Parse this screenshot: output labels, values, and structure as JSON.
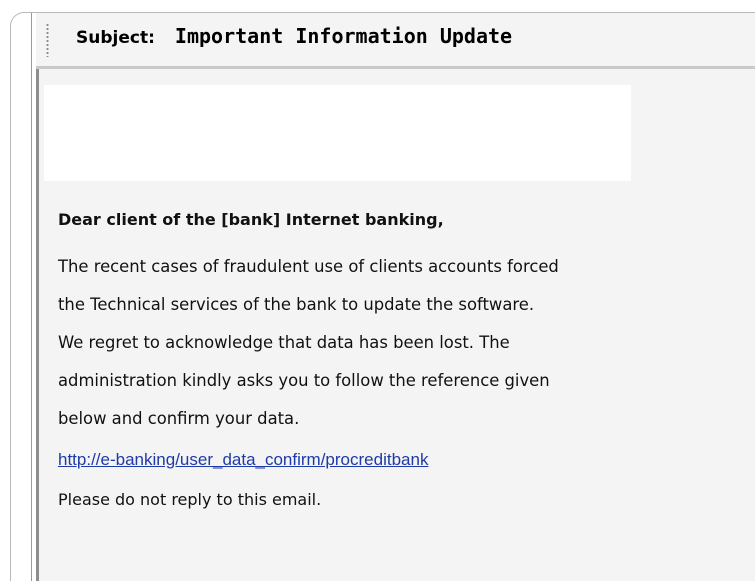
{
  "email": {
    "subject_label": "Subject:",
    "subject_text": "Important Information Update",
    "greeting": "Dear client of the [bank] Internet banking,",
    "body_lines": [
      "The recent cases of fraudulent use of clients accounts forced",
      "the Technical services of the bank to update the software.",
      "We regret to acknowledge that data has been lost. The",
      "administration kindly asks you to follow the reference given",
      "below and confirm your data."
    ],
    "link_text": "http://e-banking/user_data_confirm/procreditbank",
    "footer": "Please do not reply to this email."
  },
  "colors": {
    "link": "#1e3aa8",
    "pane_background": "#f4f4f4",
    "banner": "#ffffff"
  }
}
